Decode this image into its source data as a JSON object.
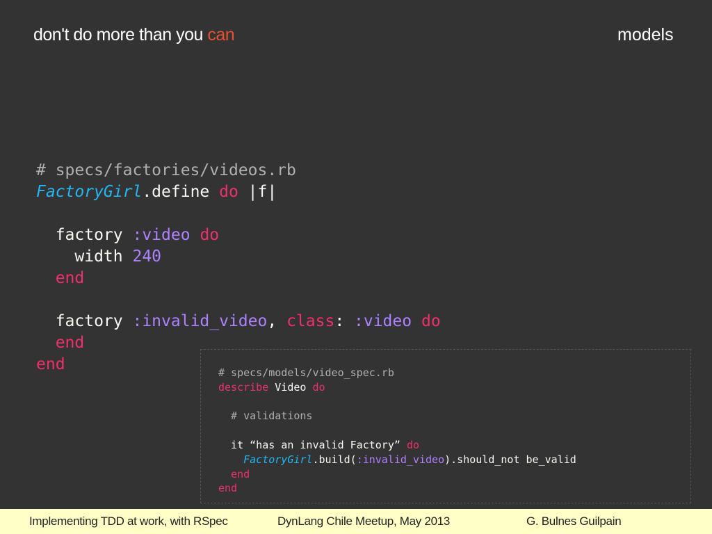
{
  "slide": {
    "title_prefix": "don't do more than you ",
    "title_accent": "can",
    "section": "models",
    "accent_color": "#e8502f"
  },
  "code_main": {
    "lines": [
      [
        [
          "cm",
          "# specs/factories/videos.rb"
        ]
      ],
      [
        [
          "cls",
          "FactoryGirl"
        ],
        [
          "pl",
          ".define "
        ],
        [
          "kw",
          "do"
        ],
        [
          "pl",
          " |f|"
        ]
      ],
      [],
      [
        [
          "pl",
          "  factory "
        ],
        [
          "sym",
          ":video"
        ],
        [
          "pl",
          " "
        ],
        [
          "kw",
          "do"
        ]
      ],
      [
        [
          "pl",
          "    width "
        ],
        [
          "sym",
          "240"
        ]
      ],
      [
        [
          "kw",
          "  end"
        ]
      ],
      [],
      [
        [
          "pl",
          "  factory "
        ],
        [
          "sym",
          ":invalid_video"
        ],
        [
          "pl",
          ", "
        ],
        [
          "kw",
          "class"
        ],
        [
          "pl",
          ": "
        ],
        [
          "sym",
          ":video"
        ],
        [
          "pl",
          " "
        ],
        [
          "kw",
          "do"
        ]
      ],
      [
        [
          "kw",
          "  end"
        ]
      ],
      [
        [
          "kw",
          "end"
        ]
      ]
    ]
  },
  "code_spec": {
    "lines": [
      [
        [
          "cm",
          "# specs/models/video_spec.rb"
        ]
      ],
      [
        [
          "kw",
          "describe"
        ],
        [
          "pl",
          " Video "
        ],
        [
          "kw",
          "do"
        ]
      ],
      [],
      [
        [
          "cm",
          "  # validations"
        ]
      ],
      [],
      [
        [
          "pl",
          "  it “has an invalid Factory” "
        ],
        [
          "kw",
          "do"
        ]
      ],
      [
        [
          "pl",
          "    "
        ],
        [
          "cls",
          "FactoryGirl"
        ],
        [
          "pl",
          ".build("
        ],
        [
          "sym",
          ":invalid_video"
        ],
        [
          "pl",
          ").should_not be_valid"
        ]
      ],
      [
        [
          "kw",
          "  end"
        ]
      ],
      [
        [
          "kw",
          "end"
        ]
      ]
    ]
  },
  "footer": {
    "left": "Implementing TDD at work, with RSpec",
    "center": "DynLang Chile Meetup, May 2013",
    "right": "G. Bulnes Guilpain"
  }
}
